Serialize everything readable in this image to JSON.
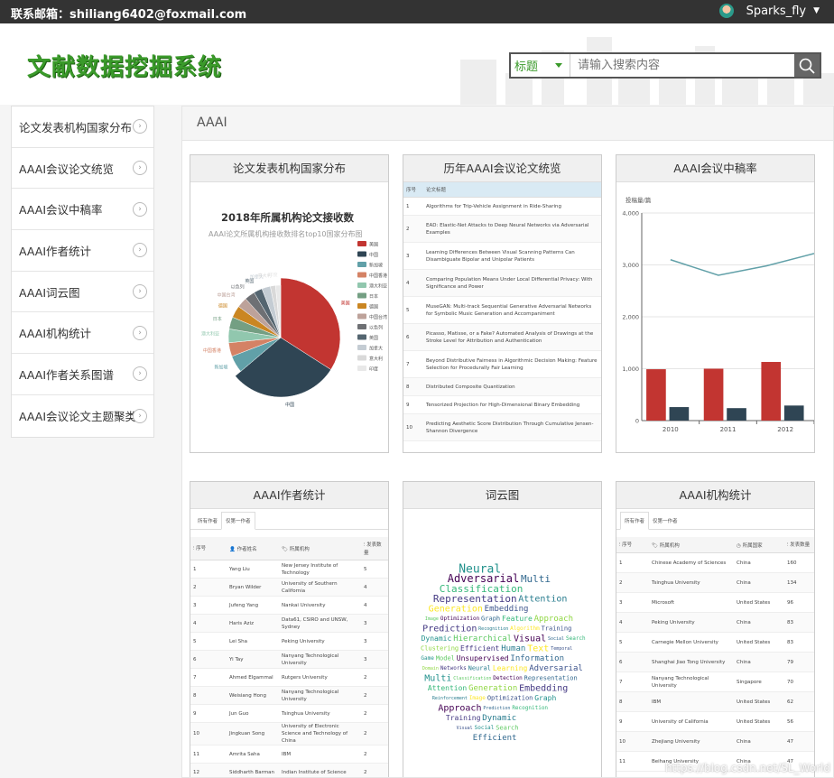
{
  "topbar": {
    "email": "联系邮箱：shiliang6402@foxmail.com",
    "username": "Sparks_fly"
  },
  "header": {
    "logo": "文献数据挖掘系统"
  },
  "search": {
    "field_selected": "标题",
    "placeholder": "请输入搜索内容"
  },
  "sidebar": {
    "items": [
      "论文发表机构国家分布",
      "AAAI会议论文统览",
      "AAAI会议中稿率",
      "AAAI作者统计",
      "AAAI词云图",
      "AAAI机构统计",
      "AAAI作者关系图谱",
      "AAAI会议论文主题聚类"
    ]
  },
  "breadcrumb": "AAAI",
  "panels": {
    "country": {
      "title": "论文发表机构国家分布"
    },
    "papers": {
      "title": "历年AAAI会议论文统览"
    },
    "accept": {
      "title": "AAAI会议中稿率"
    },
    "authors": {
      "title": "AAAI作者统计"
    },
    "wordcloud": {
      "title": "词云图"
    },
    "institutions": {
      "title": "AAAI机构统计"
    }
  },
  "chart_data": [
    {
      "type": "pie",
      "title": "2018年所属机构论文接收数",
      "subtitle": "AAAI论文所属机构接收数排名top10国家分布图",
      "slices": [
        {
          "label": "美国",
          "value": 32,
          "color": "#c23531"
        },
        {
          "label": "中国",
          "value": 28,
          "color": "#2f4554"
        },
        {
          "label": "新加坡",
          "value": 5,
          "color": "#61a0a8"
        },
        {
          "label": "中国香港",
          "value": 4,
          "color": "#d48265"
        },
        {
          "label": "澳大利亚",
          "value": 4,
          "color": "#91c7ae"
        },
        {
          "label": "日本",
          "value": 3.5,
          "color": "#749f83"
        },
        {
          "label": "德国",
          "value": 3.5,
          "color": "#ca8622"
        },
        {
          "label": "中国台湾",
          "value": 3,
          "color": "#bda29a"
        },
        {
          "label": "以色列",
          "value": 3,
          "color": "#6e7074"
        },
        {
          "label": "英国",
          "value": 2.5,
          "color": "#546570"
        },
        {
          "label": "加拿大",
          "value": 2.5,
          "color": "#c4ccd3"
        },
        {
          "label": "意大利",
          "value": 1.5,
          "color": "#d9d9d9"
        },
        {
          "label": "印度",
          "value": 1.5,
          "color": "#e8e8e8"
        }
      ]
    },
    {
      "type": "bar",
      "ylabel": "投稿量/篇",
      "categories": [
        "2010",
        "2011",
        "2012"
      ],
      "ylim": [
        0,
        4000
      ],
      "yticks": [
        "0",
        "1,000",
        "2,000",
        "3,000",
        "4,000"
      ],
      "series": [
        {
          "values": [
            990,
            1000,
            1130
          ],
          "color": "#c23531"
        },
        {
          "values": [
            260,
            240,
            290
          ],
          "color": "#2f4554"
        }
      ],
      "line": {
        "values": [
          3100,
          2800,
          2980,
          3220
        ],
        "color": "#61a0a8"
      }
    }
  ],
  "papers_table": {
    "headers": [
      "序号",
      "论文标题"
    ],
    "rows": [
      [
        "1",
        "Algorithms for Trip-Vehicle Assignment in Ride-Sharing"
      ],
      [
        "2",
        "EAD: Elastic-Net Attacks to Deep Neural Networks via Adversarial Examples"
      ],
      [
        "3",
        "Learning Differences Between Visual Scanning Patterns Can Disambiguate Bipolar and Unipolar Patients"
      ],
      [
        "4",
        "Comparing Population Means Under Local Differential Privacy: With Significance and Power"
      ],
      [
        "5",
        "MuseGAN: Multi-track Sequential Generative Adversarial Networks for Symbolic Music Generation and Accompaniment"
      ],
      [
        "6",
        "Picasso, Matisse, or a Fake? Automated Analysis of Drawings at the Stroke Level for Attribution and Authentication"
      ],
      [
        "7",
        "Beyond Distributive Fairness in Algorithmic Decision Making: Feature Selection for Procedurally Fair Learning"
      ],
      [
        "8",
        "Distributed Composite Quantization"
      ],
      [
        "9",
        "Tensorized Projection for High-Dimensional Binary Embedding"
      ],
      [
        "10",
        "Predicting Aesthetic Score Distribution Through Cumulative Jensen-Shannon Divergence"
      ]
    ]
  },
  "authors_table": {
    "tabs": [
      "所有作者",
      "仅第一作者"
    ],
    "headers": [
      "序号",
      "作者姓名",
      "所属机构",
      "发表数量"
    ],
    "rows": [
      [
        "1",
        "Yang Liu",
        "New Jersey Institute of Technology",
        "5"
      ],
      [
        "2",
        "Bryan Wilder",
        "University of Southern California",
        "4"
      ],
      [
        "3",
        "Jufeng Yang",
        "Nankai University",
        "4"
      ],
      [
        "4",
        "Haris Aziz",
        "Data61, CSIRO and UNSW, Sydney",
        "3"
      ],
      [
        "5",
        "Lei Sha",
        "Peking University",
        "3"
      ],
      [
        "6",
        "Yi Tay",
        "Nanyang Technological University",
        "3"
      ],
      [
        "7",
        "Ahmed Elgammal",
        "Rutgers University",
        "2"
      ],
      [
        "8",
        "Weisiang Hong",
        "Nanyang Technological University",
        "2"
      ],
      [
        "9",
        "Jun Guo",
        "Tsinghua University",
        "2"
      ],
      [
        "10",
        "Jingkuan Song",
        "University of Electronic Science and Technology of China",
        "2"
      ],
      [
        "11",
        "Amrita Saha",
        "IBM",
        "2"
      ],
      [
        "12",
        "Siddharth Barman",
        "Indian Institute of Science",
        "2"
      ]
    ]
  },
  "inst_table": {
    "tabs": [
      "所有作者",
      "仅第一作者"
    ],
    "headers": [
      "序号",
      "所属机构",
      "所属国家",
      "发表数量"
    ],
    "rows": [
      [
        "1",
        "Chinese Academy of Sciences",
        "China",
        "160"
      ],
      [
        "2",
        "Tsinghua University",
        "China",
        "134"
      ],
      [
        "3",
        "Microsoft",
        "United States",
        "96"
      ],
      [
        "4",
        "Peking University",
        "China",
        "83"
      ],
      [
        "5",
        "Carnegie Mellon University",
        "United States",
        "83"
      ],
      [
        "6",
        "Shanghai Jiao Tong University",
        "China",
        "79"
      ],
      [
        "7",
        "Nanyang Technological University",
        "Singapore",
        "70"
      ],
      [
        "8",
        "IBM",
        "United States",
        "62"
      ],
      [
        "9",
        "University of California",
        "United States",
        "56"
      ],
      [
        "10",
        "Zhejiang University",
        "China",
        "47"
      ],
      [
        "11",
        "Beihang University",
        "China",
        "47"
      ]
    ]
  },
  "wordcloud": {
    "words": [
      "Networks",
      "Neural",
      "Learning",
      "Adversarial",
      "Multi",
      "Classification",
      "Detection",
      "Representation",
      "Attention",
      "Generation",
      "Embedding",
      "Reinforcement",
      "Image",
      "Optimization",
      "Graph",
      "Feature",
      "Approach",
      "Prediction",
      "Recognition",
      "Algorithm",
      "Training",
      "Dynamic",
      "Hierarchical",
      "Visual",
      "Social",
      "Search",
      "Clustering",
      "Efficient",
      "Human",
      "Text",
      "Temporal",
      "Game",
      "Model",
      "Unsupervised",
      "Information",
      "System",
      "Domain"
    ]
  },
  "watermark": "https://blog.csdn.net/SL_World"
}
